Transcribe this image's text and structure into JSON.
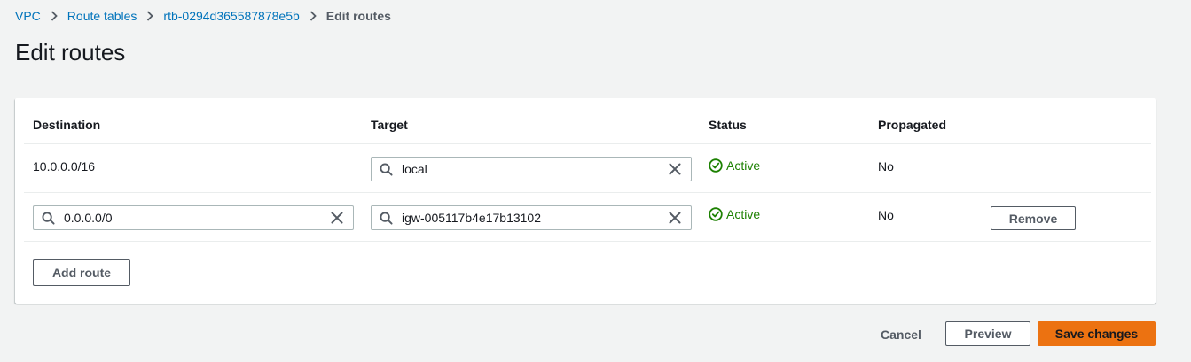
{
  "breadcrumb": {
    "items": [
      "VPC",
      "Route tables",
      "rtb-0294d365587878e5b"
    ],
    "current": "Edit routes"
  },
  "page": {
    "title": "Edit routes"
  },
  "table": {
    "columns": [
      "Destination",
      "Target",
      "Status",
      "Propagated"
    ],
    "rows": [
      {
        "destination": "10.0.0.0/16",
        "target": "local",
        "status": "Active",
        "propagated": "No"
      },
      {
        "destination": "0.0.0.0/0",
        "target": "igw-005117b4e17b13102",
        "status": "Active",
        "propagated": "No",
        "remove_label": "Remove"
      }
    ],
    "add_route_label": "Add route"
  },
  "footer": {
    "cancel_label": "Cancel",
    "preview_label": "Preview",
    "save_label": "Save changes"
  },
  "colors": {
    "link": "#0073bb",
    "success": "#1d8102",
    "primary": "#ec7211"
  }
}
